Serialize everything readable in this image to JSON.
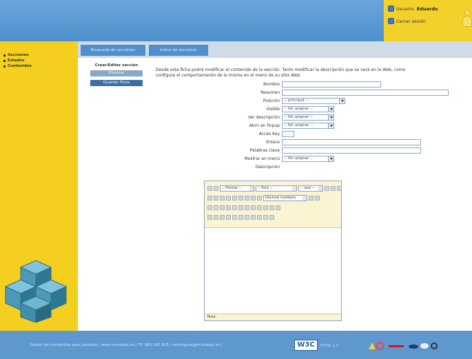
{
  "header": {
    "user_label": "Usuario:",
    "user_name": "Eduardo",
    "logout_label": "Cerrar sesión"
  },
  "sidebar": {
    "items": [
      {
        "label": "Secciones"
      },
      {
        "label": "Estados"
      },
      {
        "label": "Contenidos"
      }
    ]
  },
  "tabs": [
    {
      "label": "Búsqueda de secciones"
    },
    {
      "label": "Índice de secciones"
    }
  ],
  "left_panel": {
    "heading": "Crear/Editar sección",
    "delete_button": "Eliminar",
    "save_button": "Guardar Ficha"
  },
  "form": {
    "intro": "Desde esta ficha podrá modificar el contenido de la sección. Tanto modificar la descripción que se verá en la Web, como configure el comportamiento de la misma en el menú de su sitio Web.",
    "fields": {
      "nombre_label": "Nombre",
      "resumen_label": "Resumen",
      "posicion_label": "Posición",
      "posicion_value": "-- principal --",
      "visible_label": "Visible",
      "visible_value": "-- Sin asignar --",
      "ver_desc_label": "Ver descripción",
      "ver_desc_value": "-- Sin asignar --",
      "popup_label": "Abrir en Popup",
      "popup_value": "-- Sin asignar --",
      "accesskey_label": "Acces Key",
      "enlace_label": "Enlace",
      "palabras_label": "Palabras clave",
      "mostrar_menu_label": "Mostrar en menú",
      "mostrar_menu_value": "-- Sin asignar --",
      "descripcion_label": "Descripción"
    }
  },
  "editor": {
    "format_select": "-- Format --",
    "font_select": "-- Font --",
    "size_select": "-- size --",
    "list_select": "Decimal numbers",
    "status": "Ruta:"
  },
  "footer": {
    "text": "Gestor de contenidos para portales | www.mundopc.es | TF: 985 162 815 | emdriguez@mundopc.es |",
    "w3c": "W3C",
    "w3c_sub": "XHTML 1.0"
  },
  "colors": {
    "header_blue": "#5b9bd5",
    "sidebar_yellow": "#f4cf1f",
    "tab_blue": "#4f8fcb",
    "button_blue": "#3b6ea5",
    "footer_blue": "#5f97cf"
  }
}
